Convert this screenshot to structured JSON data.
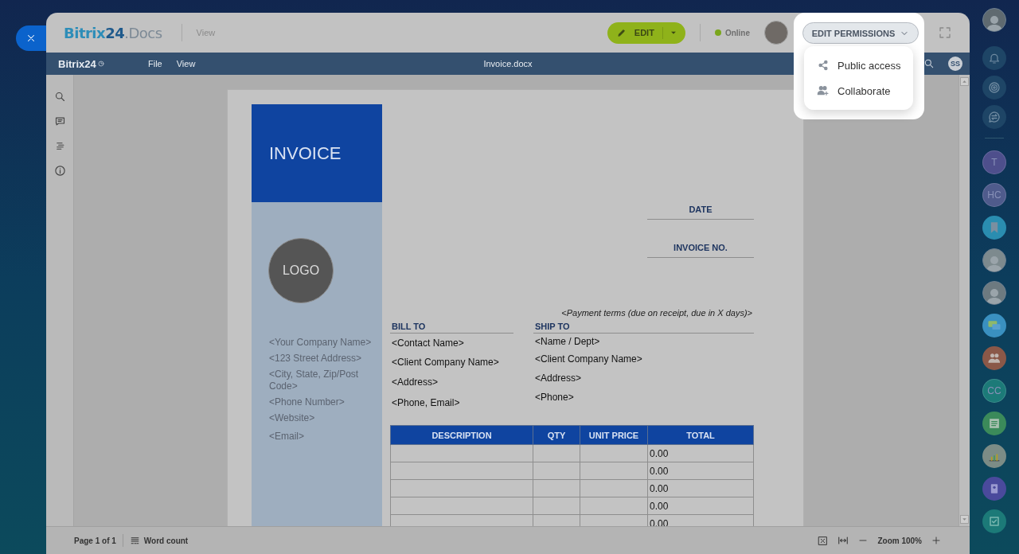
{
  "header": {
    "logo": {
      "name": "Bitrix",
      "number": "24",
      "suffix": ".Docs"
    },
    "mode": "View",
    "edit_button": "EDIT",
    "status": "Online",
    "permissions_button": "EDIT PERMISSIONS"
  },
  "permissions_menu": [
    {
      "kind": "share",
      "label": "Public access"
    },
    {
      "kind": "add-user",
      "label": "Collaborate"
    }
  ],
  "toolbar": {
    "logo": "Bitrix24",
    "menus": [
      "File",
      "View"
    ],
    "filename": "Invoice.docx",
    "user_initials": "SS"
  },
  "document": {
    "title": "INVOICE",
    "logo": "LOGO",
    "company_lines": [
      "<Your Company Name>",
      "<123 Street Address>",
      "<City, State, Zip/Post Code>",
      "<Phone Number>",
      "<Website>",
      "<Email>"
    ],
    "date_label": "DATE",
    "invoice_no_label": "INVOICE NO.",
    "payment_terms": "<Payment terms (due on receipt, due in X days)>",
    "bill_to": {
      "heading": "BILL TO",
      "lines": [
        "<Contact Name>",
        "<Client Company Name>",
        "<Address>",
        "<Phone, Email>"
      ]
    },
    "ship_to": {
      "heading": "SHIP TO",
      "lines": [
        "<Name / Dept>",
        "<Client Company Name>",
        "<Address>",
        "<Phone>"
      ]
    },
    "table": {
      "columns": [
        "DESCRIPTION",
        "QTY",
        "UNIT PRICE",
        "TOTAL"
      ],
      "rows": [
        {
          "total": "0.00"
        },
        {
          "total": "0.00"
        },
        {
          "total": "0.00"
        },
        {
          "total": "0.00"
        },
        {
          "total": "0.00"
        }
      ]
    }
  },
  "status_bar": {
    "page": "Page 1 of 1",
    "word_count": "Word count",
    "zoom": "Zoom 100%"
  },
  "right_rail": {
    "top": [
      {
        "kind": "avatar"
      },
      {
        "kind": "bell"
      },
      {
        "kind": "target"
      },
      {
        "kind": "chat-swap"
      }
    ],
    "items": [
      {
        "kind": "initials",
        "text": "T",
        "color": "#4e4f8c"
      },
      {
        "kind": "initials",
        "text": "HC",
        "color": "#4f5b8c"
      },
      {
        "kind": "bookmark",
        "color": "#2a8db0"
      },
      {
        "kind": "avatar",
        "color": "#7d8a8e"
      },
      {
        "kind": "avatar",
        "color": "#6d7a80"
      },
      {
        "kind": "chat",
        "color": "#3a90c0"
      },
      {
        "kind": "people",
        "color": "#8a5848"
      },
      {
        "kind": "initials",
        "text": "CC",
        "color": "#1c7a78"
      },
      {
        "kind": "news",
        "color": "#3b8a5a"
      },
      {
        "kind": "chart",
        "color": "#7c8c86"
      },
      {
        "kind": "contact",
        "color": "#4a4a9c"
      },
      {
        "kind": "task",
        "color": "#1c7a78"
      }
    ]
  }
}
